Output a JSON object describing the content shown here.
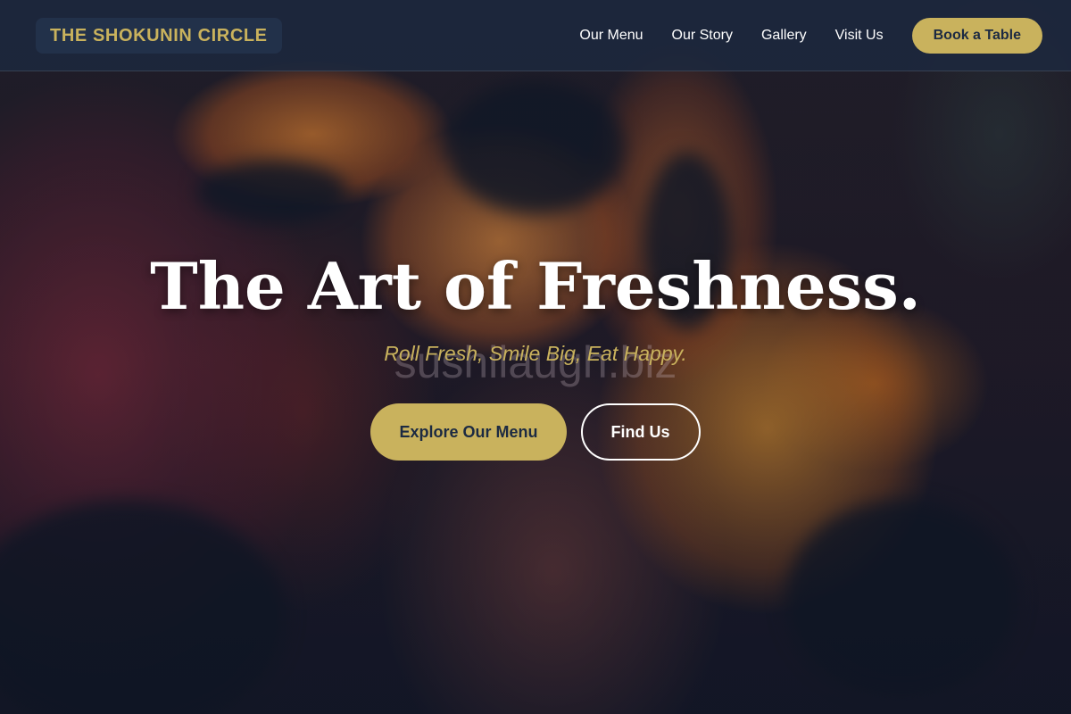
{
  "brand": {
    "name": "THE SHOKUNIN CIRCLE",
    "accent_color": "#c9b25d",
    "header_color": "#1c2a42"
  },
  "nav": {
    "items": [
      {
        "label": "Our Menu"
      },
      {
        "label": "Our Story"
      },
      {
        "label": "Gallery"
      },
      {
        "label": "Visit Us"
      }
    ],
    "cta_label": "Book a Table"
  },
  "hero": {
    "title": "The Art of Freshness.",
    "tagline": "Roll Fresh, Smile Big, Eat Happy.",
    "watermark": "sushilaugh.biz",
    "primary_button": "Explore Our Menu",
    "secondary_button": "Find Us",
    "background": "blurred street of glowing orange paper lanterns"
  }
}
